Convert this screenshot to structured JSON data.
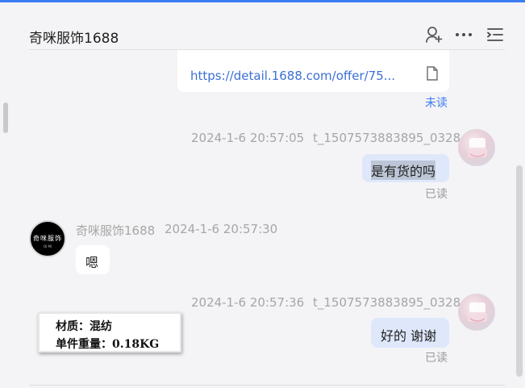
{
  "header": {
    "title": "奇咪服饰1688",
    "icons": [
      "add-contact-icon",
      "more-icon",
      "menu-list-icon"
    ]
  },
  "link_card": {
    "url_text": "https://detail.1688.com/offer/75...",
    "status": "未读"
  },
  "messages": [
    {
      "sender": "t_1507573883895_0328",
      "time": "2024-1-6 20:57:05",
      "text": "是有货的吗",
      "status": "已读"
    },
    {
      "sender": "奇咪服饰1688",
      "time": "2024-1-6 20:57:30",
      "text": "嗯"
    },
    {
      "sender": "t_1507573883895_0328",
      "time": "2024-1-6 20:57:36",
      "text": "好的 谢谢",
      "status": "已读"
    }
  ],
  "shop_avatar": {
    "logo_text": "奇咪服饰",
    "logo_sub": "QI MI"
  },
  "sticker": {
    "line1": "材质：混纺",
    "line2": "单件重量：0.18KG"
  },
  "colors": {
    "accent": "#3b7cf3",
    "link": "#3b6fd6",
    "my_bubble": "#dfe8fb",
    "meta_gray": "#a6a6a6"
  }
}
